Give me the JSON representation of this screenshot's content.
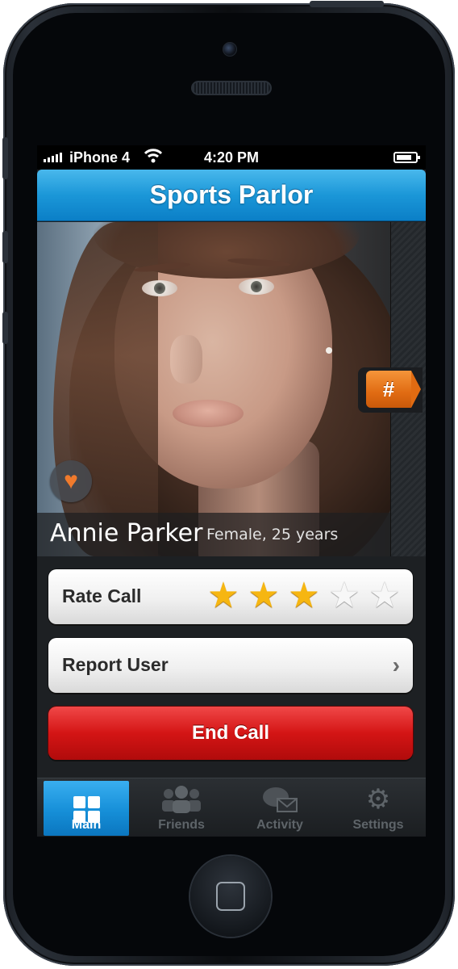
{
  "status_bar": {
    "carrier": "iPhone 4",
    "time": "4:20 PM"
  },
  "header": {
    "title": "Sports Parlor"
  },
  "profile": {
    "name": "Annie Parker",
    "meta": "Female, 25 years",
    "hash_tag": "#",
    "like_icon": "heart-icon"
  },
  "rating": {
    "label": "Rate Call",
    "stars_max": 5,
    "stars_value": 3
  },
  "report": {
    "label": "Report User",
    "icon": "chevron-right-icon"
  },
  "end_call": {
    "label": "End Call"
  },
  "tabs": [
    {
      "label": "Main",
      "icon": "grid-icon",
      "active": true
    },
    {
      "label": "Friends",
      "icon": "people-icon",
      "active": false
    },
    {
      "label": "Activity",
      "icon": "chat-mail-icon",
      "active": false
    },
    {
      "label": "Settings",
      "icon": "gear-icon",
      "active": false
    }
  ],
  "colors": {
    "nav_blue": "#1b97d8",
    "accent_orange": "#e06b12",
    "end_call_red": "#d41515",
    "star_gold": "#f6b611"
  }
}
